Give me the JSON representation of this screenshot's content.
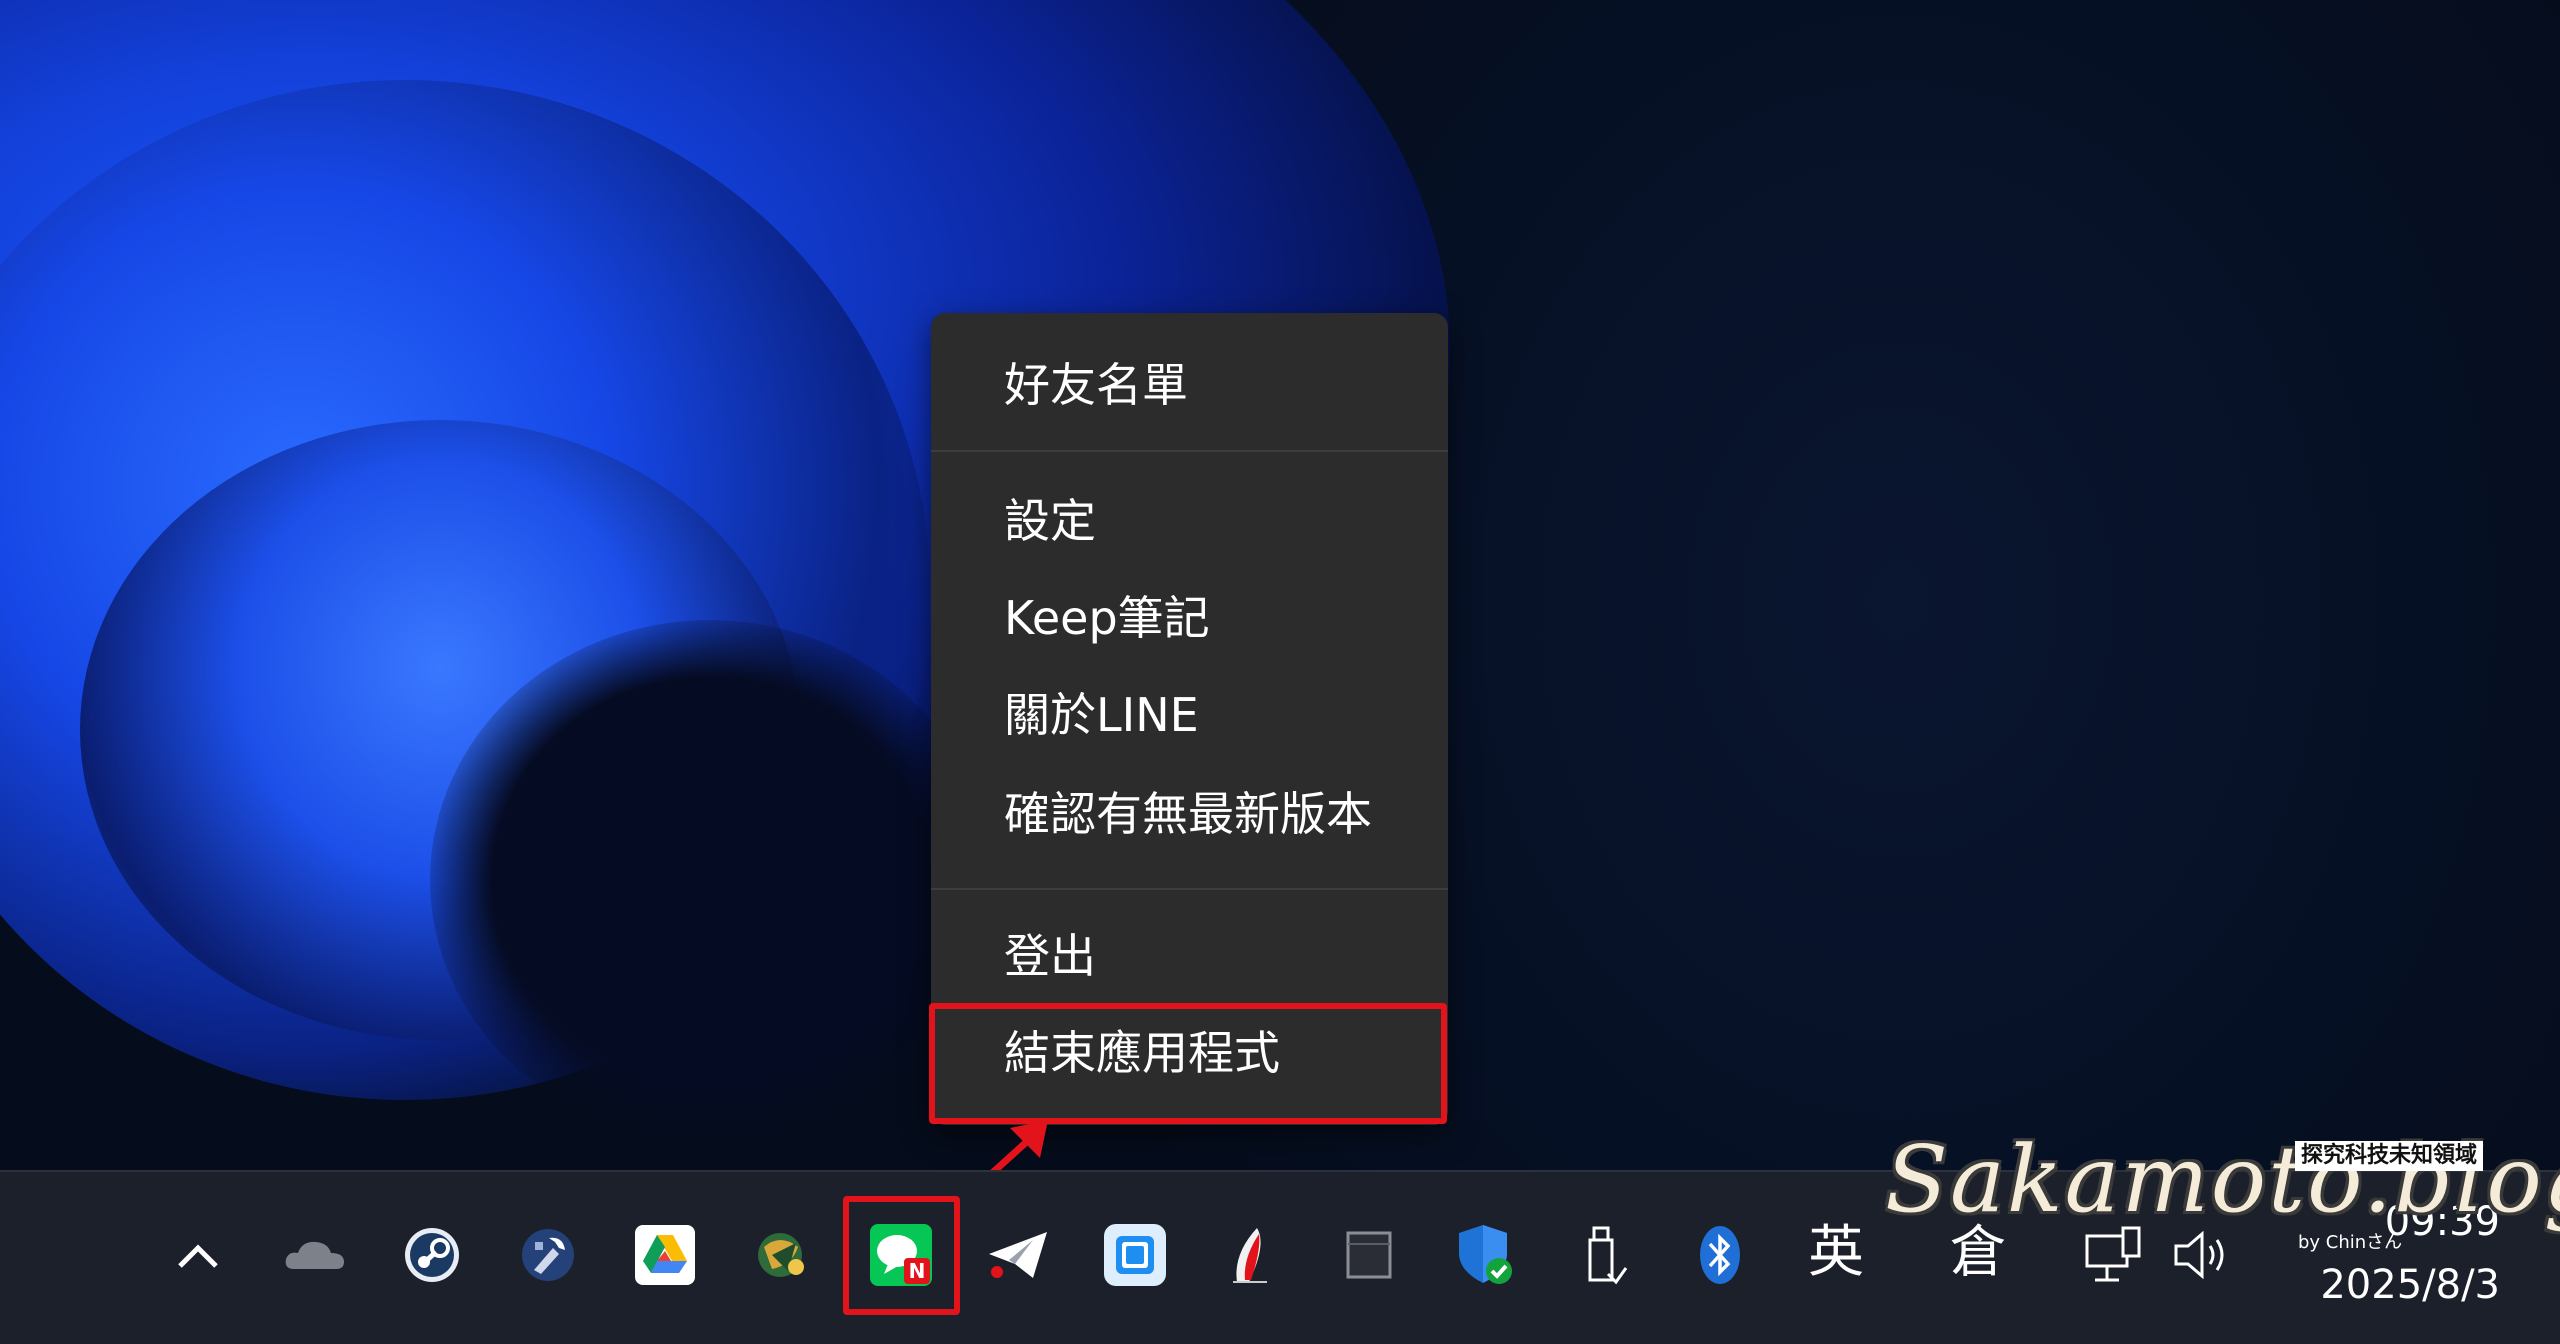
{
  "context_menu": {
    "items": [
      {
        "label": "好友名單"
      },
      {
        "label": "設定"
      },
      {
        "label": "Keep筆記"
      },
      {
        "label": "關於LINE"
      },
      {
        "label": "確認有無最新版本"
      },
      {
        "label": "登出"
      },
      {
        "label": "結束應用程式"
      }
    ],
    "highlighted_item": "結束應用程式"
  },
  "taskbar": {
    "tray_icons": [
      "chevron-up-icon",
      "onedrive-cloud-icon",
      "steam-icon",
      "dev-tools-icon",
      "google-drive-icon",
      "map-app-icon",
      "line-app-icon",
      "telegram-icon",
      "screen-mirror-icon",
      "pen-app-icon",
      "blank-app-icon",
      "windows-security-icon",
      "usb-eject-icon",
      "bluetooth-icon"
    ],
    "ime_mode": "英",
    "ime_input": "倉",
    "clock": {
      "time": "09:39",
      "date": "2025/8/3"
    }
  },
  "watermark": {
    "main": "Sakamoto.blog",
    "tagline": "探究科技未知領域",
    "by": "by Chinさん"
  },
  "colors": {
    "highlight": "#e3131b",
    "menu_bg": "#2c2c2c",
    "taskbar_bg": "#1c202a",
    "line_green": "#06c755"
  }
}
